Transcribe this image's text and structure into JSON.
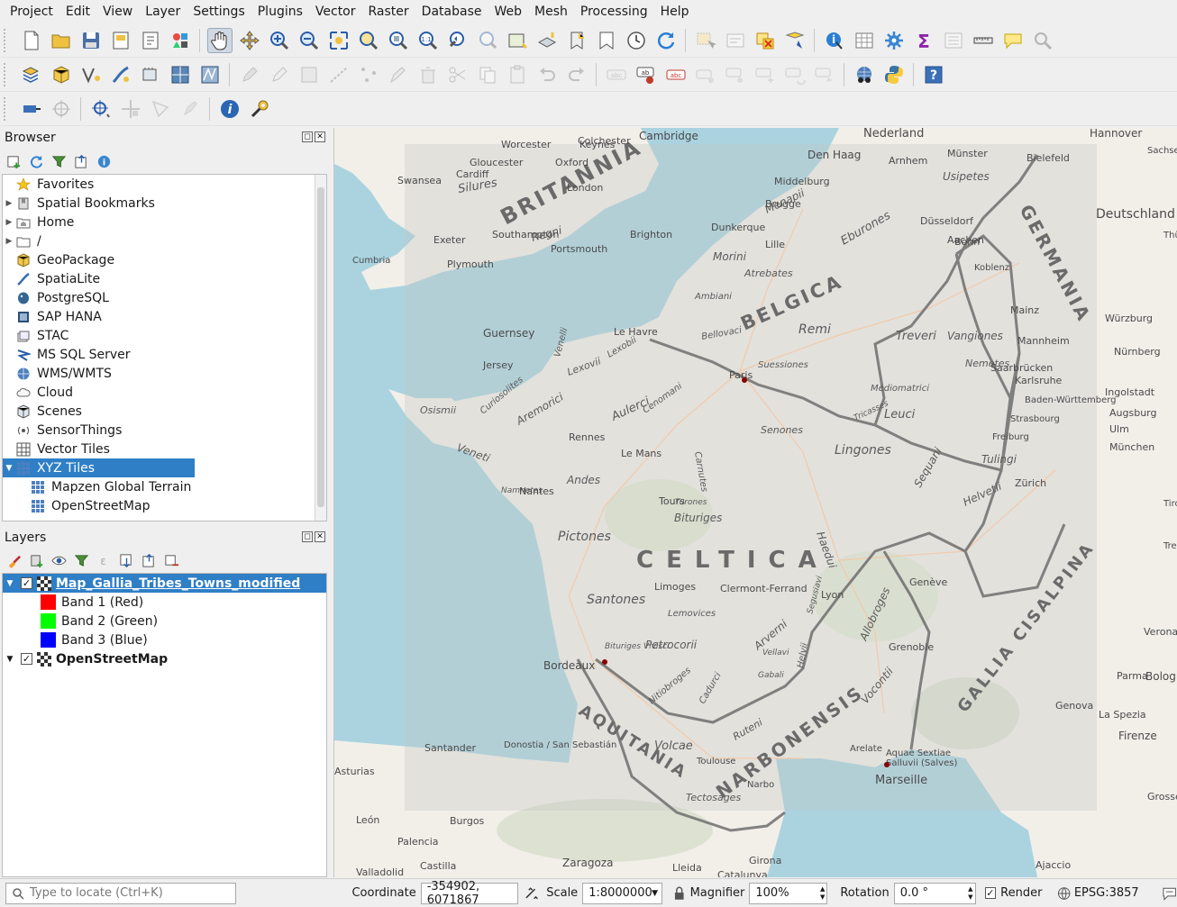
{
  "menu": [
    "Project",
    "Edit",
    "View",
    "Layer",
    "Settings",
    "Plugins",
    "Vector",
    "Raster",
    "Database",
    "Web",
    "Mesh",
    "Processing",
    "Help"
  ],
  "browser": {
    "title": "Browser",
    "items": [
      {
        "label": "Favorites",
        "arrow": "",
        "icon": "star-icon"
      },
      {
        "label": "Spatial Bookmarks",
        "arrow": "▶",
        "icon": "bookmark-icon"
      },
      {
        "label": "Home",
        "arrow": "▶",
        "icon": "home-folder-icon"
      },
      {
        "label": "/",
        "arrow": "▶",
        "icon": "folder-icon"
      },
      {
        "label": "GeoPackage",
        "arrow": "",
        "icon": "geopackage-icon"
      },
      {
        "label": "SpatiaLite",
        "arrow": "",
        "icon": "spatialite-icon"
      },
      {
        "label": "PostgreSQL",
        "arrow": "",
        "icon": "postgresql-icon"
      },
      {
        "label": "SAP HANA",
        "arrow": "",
        "icon": "sap-hana-icon"
      },
      {
        "label": "STAC",
        "arrow": "",
        "icon": "stac-icon"
      },
      {
        "label": "MS SQL Server",
        "arrow": "",
        "icon": "mssql-icon"
      },
      {
        "label": "WMS/WMTS",
        "arrow": "",
        "icon": "wms-icon"
      },
      {
        "label": "Cloud",
        "arrow": "",
        "icon": "cloud-icon"
      },
      {
        "label": "Scenes",
        "arrow": "",
        "icon": "scenes-icon"
      },
      {
        "label": "SensorThings",
        "arrow": "",
        "icon": "sensorthings-icon"
      },
      {
        "label": "Vector Tiles",
        "arrow": "",
        "icon": "vector-tiles-icon"
      },
      {
        "label": "XYZ Tiles",
        "arrow": "▼",
        "icon": "xyz-tiles-icon",
        "selected": true
      },
      {
        "label": "Mapzen Global Terrain",
        "arrow": "",
        "icon": "xyz-tiles-icon",
        "child": true
      },
      {
        "label": "OpenStreetMap",
        "arrow": "",
        "icon": "xyz-tiles-icon",
        "child": true
      }
    ]
  },
  "layers": {
    "title": "Layers",
    "items": [
      {
        "label": "Map_Gallia_Tribes_Towns_modified",
        "type": "raster",
        "checked": true,
        "selected": true
      },
      {
        "label": "Band 1 (Red)",
        "swatch": "#ff0000"
      },
      {
        "label": "Band 2 (Green)",
        "swatch": "#00ff00"
      },
      {
        "label": "Band 3 (Blue)",
        "swatch": "#0000ff"
      },
      {
        "label": "OpenStreetMap",
        "type": "raster",
        "checked": true
      }
    ]
  },
  "map": {
    "provinces": [
      "BRITANNIA",
      "BELGICA",
      "GERMANIA",
      "CELTICA",
      "AQUITANIA",
      "NARBONENSIS",
      "GALLIA CISALPINA"
    ],
    "tribes": [
      "Silures",
      "Regni",
      "Menapii",
      "Eburones",
      "Usipetes",
      "Treveri",
      "Remi",
      "Atrebates",
      "Morini",
      "Ambiani",
      "Bellovaci",
      "Suessiones",
      "Mediomatrici",
      "Leuci",
      "Vangiones",
      "Nemetes",
      "Tulingi",
      "Helvetii",
      "Sequani",
      "Lingones",
      "Senones",
      "Aulerci",
      "Aremorici",
      "Osismii",
      "Veneti",
      "Andes",
      "Pictones",
      "Bituriges",
      "Santones",
      "Lemovices",
      "Petrocorii",
      "Arverni",
      "Haedui",
      "Allobroges",
      "Vocontii",
      "Ruteni",
      "Volcae",
      "Tectosages",
      "Nitiobroges",
      "Cadurci",
      "Helvii",
      "Turones",
      "Carnutes",
      "Cenomani",
      "Lexovii",
      "Venelli",
      "Curiosolites",
      "Namnetes",
      "Tricasses",
      "Vellavi",
      "Gabali",
      "Segusiavi",
      "Bituriges Vivisci",
      "Lexobii"
    ],
    "modern": [
      "Cambridge",
      "Colchester",
      "Worcester",
      "Keynes",
      "Gloucester",
      "Oxford",
      "Swansea",
      "Cardiff",
      "London",
      "Southampton",
      "Brighton",
      "Exeter",
      "Plymouth",
      "Portsmouth",
      "Nederland",
      "Den Haag",
      "Middelburg",
      "Brugge",
      "Dunkerque",
      "Lille",
      "Arnhem",
      "Münster",
      "Bielefeld",
      "Hannover",
      "Düsseldorf",
      "Deutschland",
      "Koblenz",
      "Würzburg",
      "Nürnberg",
      "Ingolstadt",
      "Augsburg",
      "Ulm",
      "München",
      "Zürich",
      "Guernsey",
      "Jersey",
      "Le Havre",
      "Paris",
      "Le Mans",
      "Tours",
      "Rennes",
      "Nantes",
      "Bordeaux",
      "Limoges",
      "Clermont-Ferrand",
      "Lyon",
      "Genève",
      "Grenoble",
      "Marseille",
      "Toulouse",
      "Narbo",
      "Arelate",
      "Aquae Sextiae",
      "Salluvii (Salves)",
      "Santander",
      "Donostia / San Sebastián",
      "Burgos",
      "León",
      "Palencia",
      "Valladolid",
      "Zaragoza",
      "Lleida",
      "Girona",
      "Catalunya",
      "Asturias",
      "Castilla",
      "Genova",
      "La Spezia",
      "Firenze",
      "Parma",
      "Bologna",
      "Verona",
      "Trento",
      "Grosseto",
      "Ajaccio",
      "Tirol",
      "Sachsen-Anhalt",
      "Thüringen",
      "Baden-Württemberg",
      "Strasbourg",
      "Freiburg",
      "Mannheim",
      "Saarbrücken",
      "Karlsruhe",
      "Mainz",
      "Bonn",
      "Aachen",
      "Cumbria"
    ],
    "basemap_colors": {
      "sea": "#aad3df",
      "land": "#f2efe9",
      "overlay": "#c7c9c6"
    }
  },
  "status": {
    "locate_placeholder": "Type to locate (Ctrl+K)",
    "coordinate_label": "Coordinate",
    "coordinate_value": "-354902, 6071867",
    "scale_label": "Scale",
    "scale_value": "1:8000000",
    "magnifier_label": "Magnifier",
    "magnifier_value": "100%",
    "rotation_label": "Rotation",
    "rotation_value": "0.0 °",
    "render_label": "Render",
    "render_checked": true,
    "crs": "EPSG:3857"
  }
}
